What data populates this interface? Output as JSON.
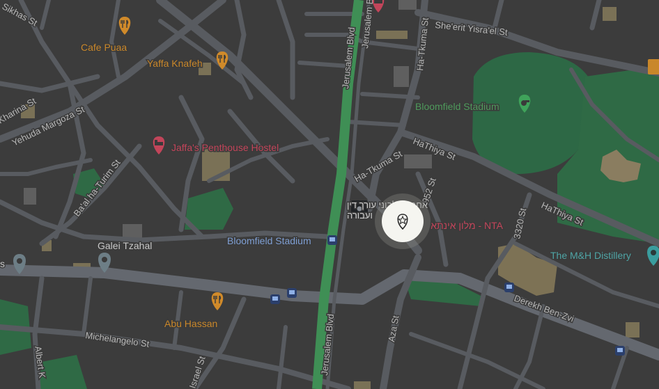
{
  "colors": {
    "background": "#3c3c3c",
    "road": "#5a5d62",
    "major_road": "#656970",
    "park": "#2f6a45",
    "stadium_field": "#2d6845",
    "building": "#6a6a6a",
    "highlight_building": "#8a7d60",
    "green_road": "#3f8f55",
    "marker_white": "#f5f5f0"
  },
  "streets": {
    "jerusalem_blvd_1": "Jerusalem Blvd",
    "jerusalem_blvd_2": "Jerusalem Blvd",
    "jerusalem_blvd_3": "Jerusalem Blvd",
    "ha_tkuma_1": "Ha-Tkuma St",
    "ha_tkuma_2": "Ha-Tkuma St",
    "sheerit_yisrael": "She'erit Yisra'el St",
    "hathiya_1": "HaThiya St",
    "hathiya_2": "HaThiya St",
    "st_3952": "3952 St",
    "st_3320": "3320 St",
    "derekh_ben_zvi": "Derekh Ben-Zvi",
    "aza_st": "Aza St",
    "michelangelo": "Michelangelo St",
    "israel_st": "Israel St",
    "albert": "Albert K",
    "yehuda_margoza": "Yehuda Margoza St",
    "kharina": "Kharina St",
    "baal_haturim": "Ba'al ha-Turim St",
    "sikhas": "Sikhas St"
  },
  "places": {
    "cafe_puaa": "Cafe Puaa",
    "yaffa_knafeh": "Yaffa Knafeh",
    "jaffas_penthouse_hostel": "Jaffa's Penthouse Hostel",
    "bloomfield_stadium_park": "Bloomfield Stadium",
    "bloomfield_stadium_transit": "Bloomfield Stadium",
    "hebrew_line1": "אחמד קלבוני עורך דין",
    "hebrew_line2": "ועבורה",
    "hotel_inta": "מלון אינתא - NTA",
    "galei_tzahal": "Galei Tzahal",
    "mh_distillery": "The M&H Distillery",
    "abu_hassan": "Abu Hassan",
    "edge_s": "s"
  },
  "icons": {
    "restaurant": "fork-knife-icon",
    "hotel": "bed-icon",
    "stadium": "whistle-icon",
    "transit": "bus-icon",
    "landmark": "pin-icon",
    "selected": "star-pin-icon",
    "distillery": "bottle-icon"
  }
}
